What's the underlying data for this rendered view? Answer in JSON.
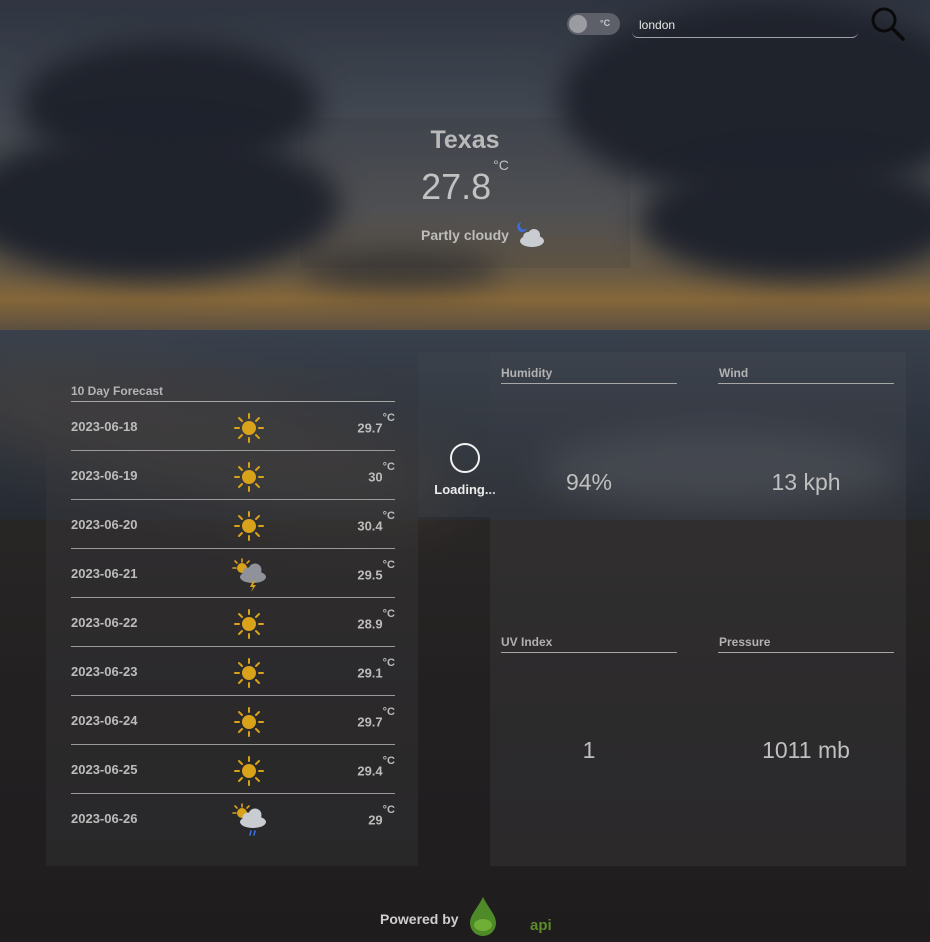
{
  "header": {
    "unit_toggle_label": "°C",
    "search_value": "london"
  },
  "current": {
    "city": "Texas",
    "temperature": "27.8",
    "unit": "°C",
    "condition": "Partly cloudy",
    "condition_icon": "partly-cloudy-night-icon"
  },
  "forecast": {
    "title": "10 Day Forecast",
    "days": [
      {
        "date": "2023-06-18",
        "temp": "29.7",
        "unit": "°C",
        "icon": "sunny-icon"
      },
      {
        "date": "2023-06-19",
        "temp": "30",
        "unit": "°C",
        "icon": "sunny-icon"
      },
      {
        "date": "2023-06-20",
        "temp": "30.4",
        "unit": "°C",
        "icon": "sunny-icon"
      },
      {
        "date": "2023-06-21",
        "temp": "29.5",
        "unit": "°C",
        "icon": "thunder-icon"
      },
      {
        "date": "2023-06-22",
        "temp": "28.9",
        "unit": "°C",
        "icon": "sunny-icon"
      },
      {
        "date": "2023-06-23",
        "temp": "29.1",
        "unit": "°C",
        "icon": "sunny-icon"
      },
      {
        "date": "2023-06-24",
        "temp": "29.7",
        "unit": "°C",
        "icon": "sunny-icon"
      },
      {
        "date": "2023-06-25",
        "temp": "29.4",
        "unit": "°C",
        "icon": "sunny-icon"
      },
      {
        "date": "2023-06-26",
        "temp": "29",
        "unit": "°C",
        "icon": "rain-icon"
      }
    ]
  },
  "loading": {
    "text": "Loading..."
  },
  "metrics": {
    "humidity": {
      "label": "Humidity",
      "value": "94%"
    },
    "wind": {
      "label": "Wind",
      "value": "13 kph"
    },
    "uv": {
      "label": "UV Index",
      "value": "1"
    },
    "pressure": {
      "label": "Pressure",
      "value": "1011 mb"
    }
  },
  "footer": {
    "powered_by": "Powered by",
    "logo_text": "api"
  },
  "colors": {
    "sun": "#d9a21b",
    "cloud": "#c9ccd1",
    "logo_green": "#5d8a2b"
  }
}
